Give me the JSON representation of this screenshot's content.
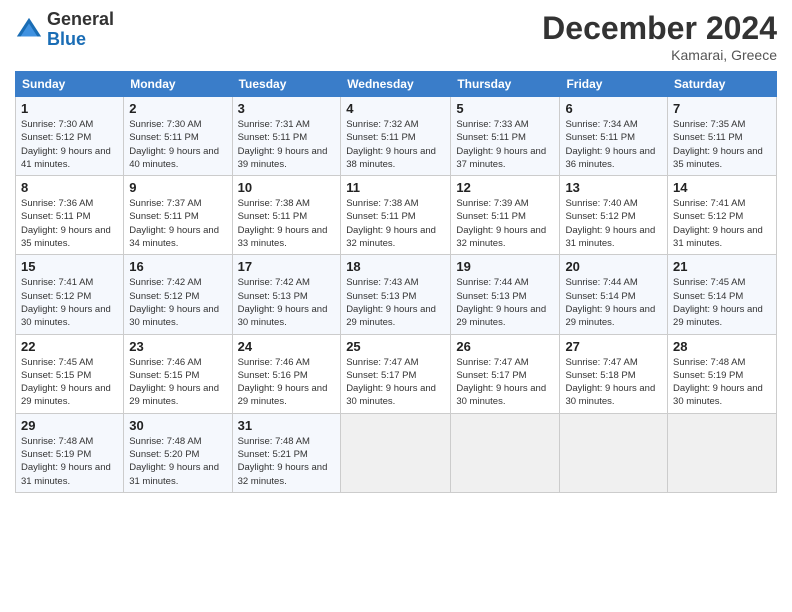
{
  "logo": {
    "general": "General",
    "blue": "Blue"
  },
  "title": "December 2024",
  "location": "Kamarai, Greece",
  "days_of_week": [
    "Sunday",
    "Monday",
    "Tuesday",
    "Wednesday",
    "Thursday",
    "Friday",
    "Saturday"
  ],
  "weeks": [
    [
      {
        "day": "1",
        "sunrise": "7:30 AM",
        "sunset": "5:12 PM",
        "daylight": "9 hours and 41 minutes."
      },
      {
        "day": "2",
        "sunrise": "7:30 AM",
        "sunset": "5:11 PM",
        "daylight": "9 hours and 40 minutes."
      },
      {
        "day": "3",
        "sunrise": "7:31 AM",
        "sunset": "5:11 PM",
        "daylight": "9 hours and 39 minutes."
      },
      {
        "day": "4",
        "sunrise": "7:32 AM",
        "sunset": "5:11 PM",
        "daylight": "9 hours and 38 minutes."
      },
      {
        "day": "5",
        "sunrise": "7:33 AM",
        "sunset": "5:11 PM",
        "daylight": "9 hours and 37 minutes."
      },
      {
        "day": "6",
        "sunrise": "7:34 AM",
        "sunset": "5:11 PM",
        "daylight": "9 hours and 36 minutes."
      },
      {
        "day": "7",
        "sunrise": "7:35 AM",
        "sunset": "5:11 PM",
        "daylight": "9 hours and 35 minutes."
      }
    ],
    [
      {
        "day": "8",
        "sunrise": "7:36 AM",
        "sunset": "5:11 PM",
        "daylight": "9 hours and 35 minutes."
      },
      {
        "day": "9",
        "sunrise": "7:37 AM",
        "sunset": "5:11 PM",
        "daylight": "9 hours and 34 minutes."
      },
      {
        "day": "10",
        "sunrise": "7:38 AM",
        "sunset": "5:11 PM",
        "daylight": "9 hours and 33 minutes."
      },
      {
        "day": "11",
        "sunrise": "7:38 AM",
        "sunset": "5:11 PM",
        "daylight": "9 hours and 32 minutes."
      },
      {
        "day": "12",
        "sunrise": "7:39 AM",
        "sunset": "5:11 PM",
        "daylight": "9 hours and 32 minutes."
      },
      {
        "day": "13",
        "sunrise": "7:40 AM",
        "sunset": "5:12 PM",
        "daylight": "9 hours and 31 minutes."
      },
      {
        "day": "14",
        "sunrise": "7:41 AM",
        "sunset": "5:12 PM",
        "daylight": "9 hours and 31 minutes."
      }
    ],
    [
      {
        "day": "15",
        "sunrise": "7:41 AM",
        "sunset": "5:12 PM",
        "daylight": "9 hours and 30 minutes."
      },
      {
        "day": "16",
        "sunrise": "7:42 AM",
        "sunset": "5:12 PM",
        "daylight": "9 hours and 30 minutes."
      },
      {
        "day": "17",
        "sunrise": "7:42 AM",
        "sunset": "5:13 PM",
        "daylight": "9 hours and 30 minutes."
      },
      {
        "day": "18",
        "sunrise": "7:43 AM",
        "sunset": "5:13 PM",
        "daylight": "9 hours and 29 minutes."
      },
      {
        "day": "19",
        "sunrise": "7:44 AM",
        "sunset": "5:13 PM",
        "daylight": "9 hours and 29 minutes."
      },
      {
        "day": "20",
        "sunrise": "7:44 AM",
        "sunset": "5:14 PM",
        "daylight": "9 hours and 29 minutes."
      },
      {
        "day": "21",
        "sunrise": "7:45 AM",
        "sunset": "5:14 PM",
        "daylight": "9 hours and 29 minutes."
      }
    ],
    [
      {
        "day": "22",
        "sunrise": "7:45 AM",
        "sunset": "5:15 PM",
        "daylight": "9 hours and 29 minutes."
      },
      {
        "day": "23",
        "sunrise": "7:46 AM",
        "sunset": "5:15 PM",
        "daylight": "9 hours and 29 minutes."
      },
      {
        "day": "24",
        "sunrise": "7:46 AM",
        "sunset": "5:16 PM",
        "daylight": "9 hours and 29 minutes."
      },
      {
        "day": "25",
        "sunrise": "7:47 AM",
        "sunset": "5:17 PM",
        "daylight": "9 hours and 30 minutes."
      },
      {
        "day": "26",
        "sunrise": "7:47 AM",
        "sunset": "5:17 PM",
        "daylight": "9 hours and 30 minutes."
      },
      {
        "day": "27",
        "sunrise": "7:47 AM",
        "sunset": "5:18 PM",
        "daylight": "9 hours and 30 minutes."
      },
      {
        "day": "28",
        "sunrise": "7:48 AM",
        "sunset": "5:19 PM",
        "daylight": "9 hours and 30 minutes."
      }
    ],
    [
      {
        "day": "29",
        "sunrise": "7:48 AM",
        "sunset": "5:19 PM",
        "daylight": "9 hours and 31 minutes."
      },
      {
        "day": "30",
        "sunrise": "7:48 AM",
        "sunset": "5:20 PM",
        "daylight": "9 hours and 31 minutes."
      },
      {
        "day": "31",
        "sunrise": "7:48 AM",
        "sunset": "5:21 PM",
        "daylight": "9 hours and 32 minutes."
      },
      null,
      null,
      null,
      null
    ]
  ]
}
